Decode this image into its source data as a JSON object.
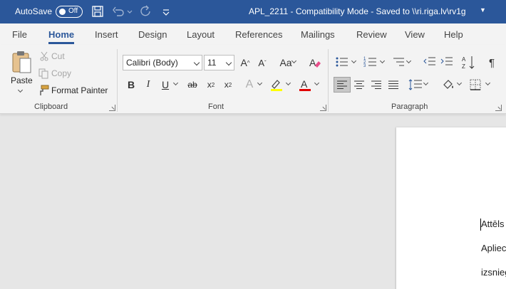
{
  "titlebar": {
    "autosave_label": "AutoSave",
    "toggle_state": "Off",
    "document_title": "APL_2211  -  Compatibility Mode  -  Saved to \\\\ri.riga.lv\\rv1g",
    "background": "#2b579a",
    "icons": [
      "save-icon",
      "undo-icon",
      "redo-icon",
      "customize-quick-access-icon"
    ]
  },
  "tabs": [
    {
      "label": "File"
    },
    {
      "label": "Home",
      "active": true
    },
    {
      "label": "Insert"
    },
    {
      "label": "Design"
    },
    {
      "label": "Layout"
    },
    {
      "label": "References"
    },
    {
      "label": "Mailings"
    },
    {
      "label": "Review"
    },
    {
      "label": "View"
    },
    {
      "label": "Help"
    }
  ],
  "clipboard": {
    "group_label": "Clipboard",
    "paste_label": "Paste",
    "cut_label": "Cut",
    "copy_label": "Copy",
    "format_painter_label": "Format Painter"
  },
  "font": {
    "group_label": "Font",
    "font_name": "Calibri (Body)",
    "font_size": "11",
    "highlight_color": "#ffff00",
    "font_color": "#e00000"
  },
  "paragraph": {
    "group_label": "Paragraph"
  },
  "document": {
    "lines": [
      "Attēls",
      "Apliec",
      "izsnieg"
    ]
  }
}
